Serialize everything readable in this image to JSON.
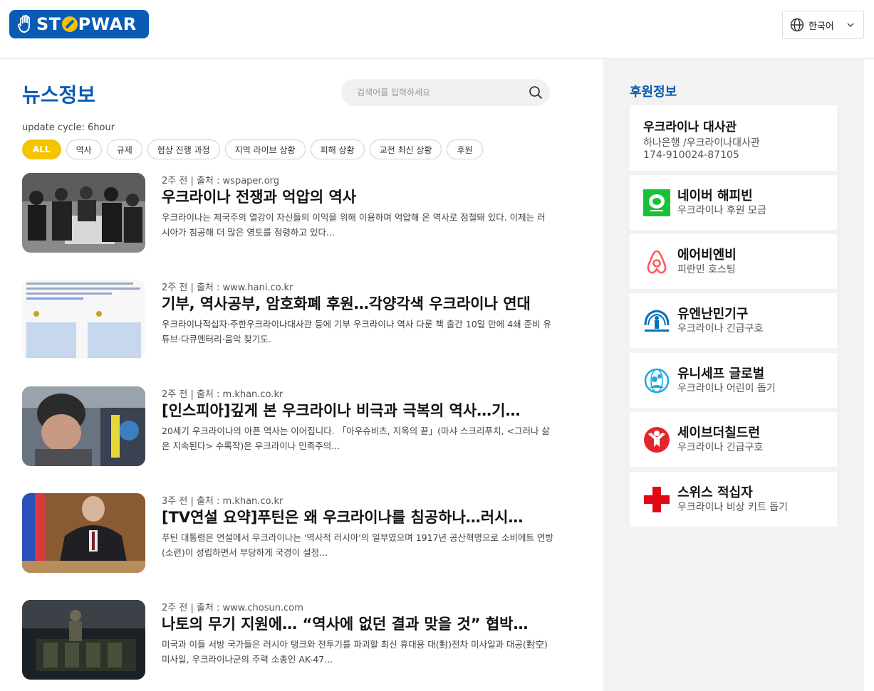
{
  "header": {
    "logo_text_1": "ST",
    "logo_text_2": "PWAR",
    "language": "한국어"
  },
  "main": {
    "title": "뉴스정보",
    "search_placeholder": "검색어를 입력하세요",
    "update_cycle": "update cycle: 6hour",
    "filters": [
      "ALL",
      "역사",
      "규제",
      "협상 진행 과정",
      "지역 라이브 상황",
      "피해 상황",
      "교전 최신 상황",
      "후원"
    ],
    "articles": [
      {
        "meta": "2주 전 | 출처 : wspaper.org",
        "title": "우크라이나 전쟁과 억압의 역사",
        "summary": "우크라이나는 제국주의 열강이 자신들의 이익을 위해 이용하며 억압해 온 역사로 점철돼 있다. 이제는 러시아가 침공해 더 많은 영토를 점령하고 있다..."
      },
      {
        "meta": "2주 전 | 출처 : www.hani.co.kr",
        "title": "기부, 역사공부, 암호화폐 후원…각양각색 우크라이나 연대",
        "summary": "우크라이나적십자·주한우크라이나대사관 등에 기부 우크라이나 역사 다룬 책 출간 10일 만에 4쇄 준비 유튜브·다큐멘터리·음악 찾기도."
      },
      {
        "meta": "2주 전 | 출처 : m.khan.co.kr",
        "title": "[인스피아]깊게 본 우크라이나 비극과 극복의 역사…기…",
        "summary": "20세기 우크라이나의 아픈 역사는 이어집니다. 「아우슈비츠, 지옥의 끝」(마샤 스크리푸치, <그러나 삶은 지속된다> 수록작)은 우크라이나 민족주의..."
      },
      {
        "meta": "3주 전 | 출처 : m.khan.co.kr",
        "title": "[TV연설 요약]푸틴은 왜 우크라이나를 침공하나…러시…",
        "summary": "푸틴 대통령은 연설에서 우크라이나는 '역사적 러시아'의 일부였으며 1917년 공산혁명으로 소비에트 연방(소련)이 성립하면서 부당하게 국경이 설정..."
      },
      {
        "meta": "2주 전 | 출처 : www.chosun.com",
        "title": "나토의 무기 지원에… “역사에 없던 결과 맞을 것” 협박…",
        "summary": "미국과 이들 서방 국가들은 러시아 탱크와 전투기를 파괴할 최신 휴대용 대(對)전차 미사일과 대공(對空)미사일, 우크라이나군의 주력 소총인 AK-47..."
      }
    ]
  },
  "side": {
    "title": "후원정보",
    "embassy": {
      "name": "우크라이나 대사관",
      "bank": "하나은행 /우크라이나대사관",
      "account": "174-910024-87105"
    },
    "orgs": [
      {
        "name": "네이버 해피빈",
        "desc": "우크라이나 후원 모금",
        "icon": "happybean-icon",
        "color": "#17c23a"
      },
      {
        "name": "에어비엔비",
        "desc": "피란민 호스팅",
        "icon": "airbnb-icon",
        "color": "#ff5a5f"
      },
      {
        "name": "유엔난민기구",
        "desc": "우크라이나 긴급구호",
        "icon": "unhcr-icon",
        "color": "#0072bc"
      },
      {
        "name": "유니세프 글로벌",
        "desc": "우크라이나 어린이 돕기",
        "icon": "unicef-icon",
        "color": "#1cabe2"
      },
      {
        "name": "세이브더칠드런",
        "desc": "우크라이나 긴급구호",
        "icon": "save-the-children-icon",
        "color": "#e4252b"
      },
      {
        "name": "스위스 적십자",
        "desc": "우크라이나 비상 키트 돕기",
        "icon": "red-cross-icon",
        "color": "#e30613"
      }
    ]
  }
}
